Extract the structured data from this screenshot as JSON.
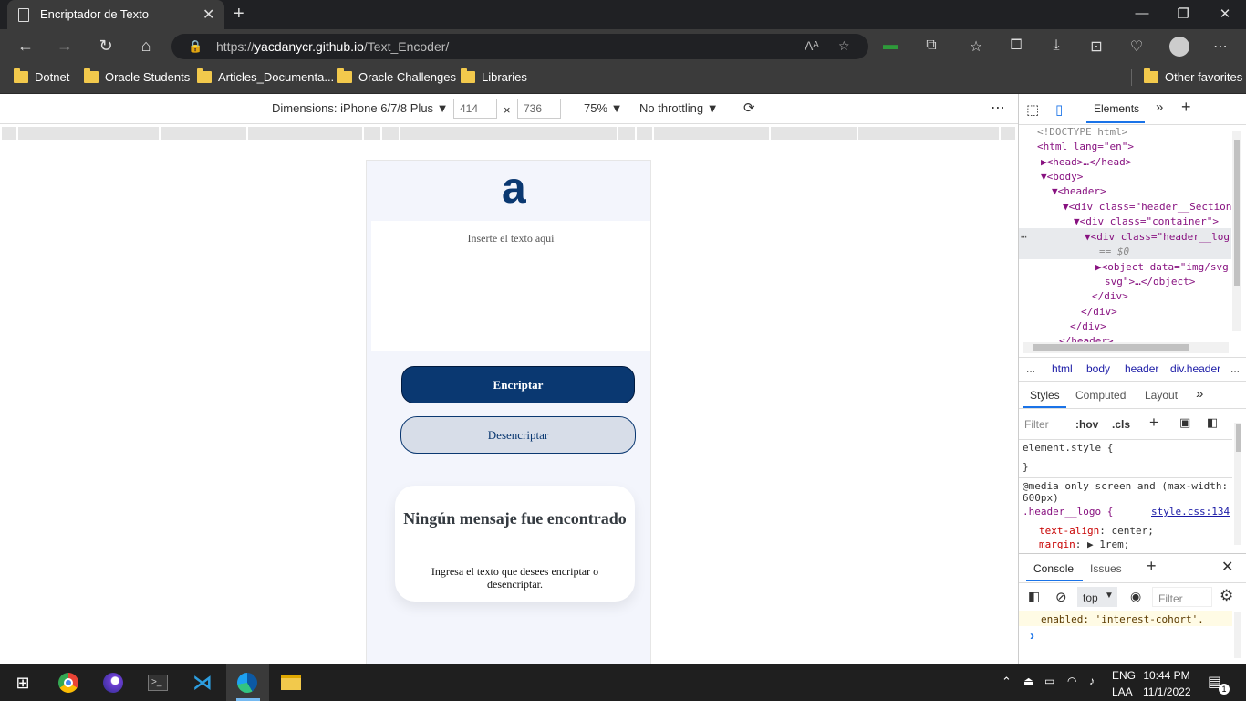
{
  "browser": {
    "tab_title": "Encriptador de Texto",
    "tab_close": "✕",
    "new_tab": "+",
    "url_scheme": "https://",
    "url_host": "yacdanycr.github.io",
    "url_path": "/Text_Encoder/",
    "read_aloud": "Aᴬ",
    "favorites": [
      "Dotnet",
      "Oracle Students",
      "Articles_Documenta...",
      "Oracle Challenges",
      "Libraries"
    ],
    "other_favorites": "Other favorites"
  },
  "device_toolbar": {
    "dimensions_label": "Dimensions: iPhone 6/7/8 Plus",
    "width": "414",
    "x": "×",
    "height": "736",
    "zoom": "75%",
    "throttling": "No throttling",
    "more": "⋮"
  },
  "app": {
    "logo": "a",
    "textarea_placeholder": "Inserte el texto aqui",
    "encrypt_label": "Encriptar",
    "decrypt_label": "Desencriptar",
    "no_message_title": "Ningún mensaje fue encontrado",
    "no_message_text": "Ingresa el texto que desees encriptar o desencriptar."
  },
  "devtools": {
    "tab_elements": "Elements",
    "dom_lines": [
      "<!DOCTYPE html>",
      "<html lang=\"en\">",
      "▶<head>…</head>",
      "▼<body>",
      "▼<header>",
      "▼<div class=\"header__Section",
      "▼<div class=\"container\">",
      "▼<div class=\"header__log",
      "== $0",
      "▶<object data=\"img/svg",
      "svg\">…</object>",
      "</div>",
      "</div>",
      "</div>",
      "</header>"
    ],
    "breadcrumbs": [
      "...",
      "html",
      "body",
      "header",
      "div.header",
      "..."
    ],
    "style_tabs": [
      "Styles",
      "Computed",
      "Layout"
    ],
    "filter_placeholder": "Filter",
    "hov": ":hov",
    "cls": ".cls",
    "element_style": "element.style {",
    "close_brace": "}",
    "media_rule": "@media only screen and (max-width: 600px)",
    "selector": ".header__logo {",
    "source": "style.css:134",
    "prop1_name": "text-align",
    "prop1_val": "center;",
    "prop2_name": "margin",
    "prop2_val": "1rem;",
    "console_tab": "Console",
    "issues_tab": "Issues",
    "context": "top",
    "console_filter": "Filter",
    "console_msg": "enabled: 'interest-cohort'.",
    "prompt": "›"
  },
  "taskbar": {
    "lang1": "ENG",
    "lang2": "LAA",
    "time": "10:44 PM",
    "date": "11/1/2022",
    "notifications": "1"
  },
  "colors": {
    "accent": "#0a3871",
    "titlebar": "#202124",
    "toolbar": "#3b3b3b",
    "phone_bg": "#f3f5fc",
    "decrypt_bg": "#d7dde8"
  }
}
